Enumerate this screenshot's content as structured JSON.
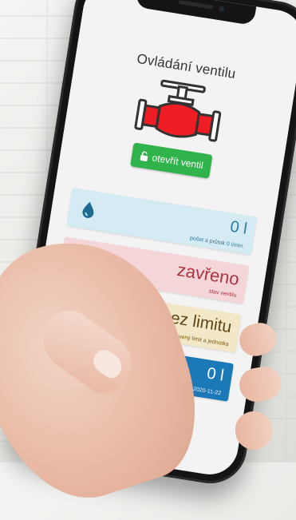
{
  "app": {
    "title": "Ovládání ventilu",
    "open_button_label": "otevřít ventil",
    "valve_icon": "valve-icon",
    "lock_icon": "unlock-icon"
  },
  "cards": [
    {
      "value": "0 l",
      "label": "počet a průtok 0 l/min.",
      "icon": "water-drop-icon",
      "color": "#d5ebf3"
    },
    {
      "value": "zavřeno",
      "label": "stav ventilu",
      "icon": "red-dot-icon",
      "color": "#f4d6d9"
    },
    {
      "value": "bez limitu",
      "label": "nastavený limit a jednotka",
      "icon": "flask-icon",
      "color": "#f2e8c7"
    },
    {
      "value": "0 l",
      "label": "celkový počet od 2020-11-22",
      "icon": "info-icon",
      "color": "#1c79b8"
    }
  ],
  "colors": {
    "valve_red": "#ee1c23",
    "button_green": "#2fb34a"
  }
}
